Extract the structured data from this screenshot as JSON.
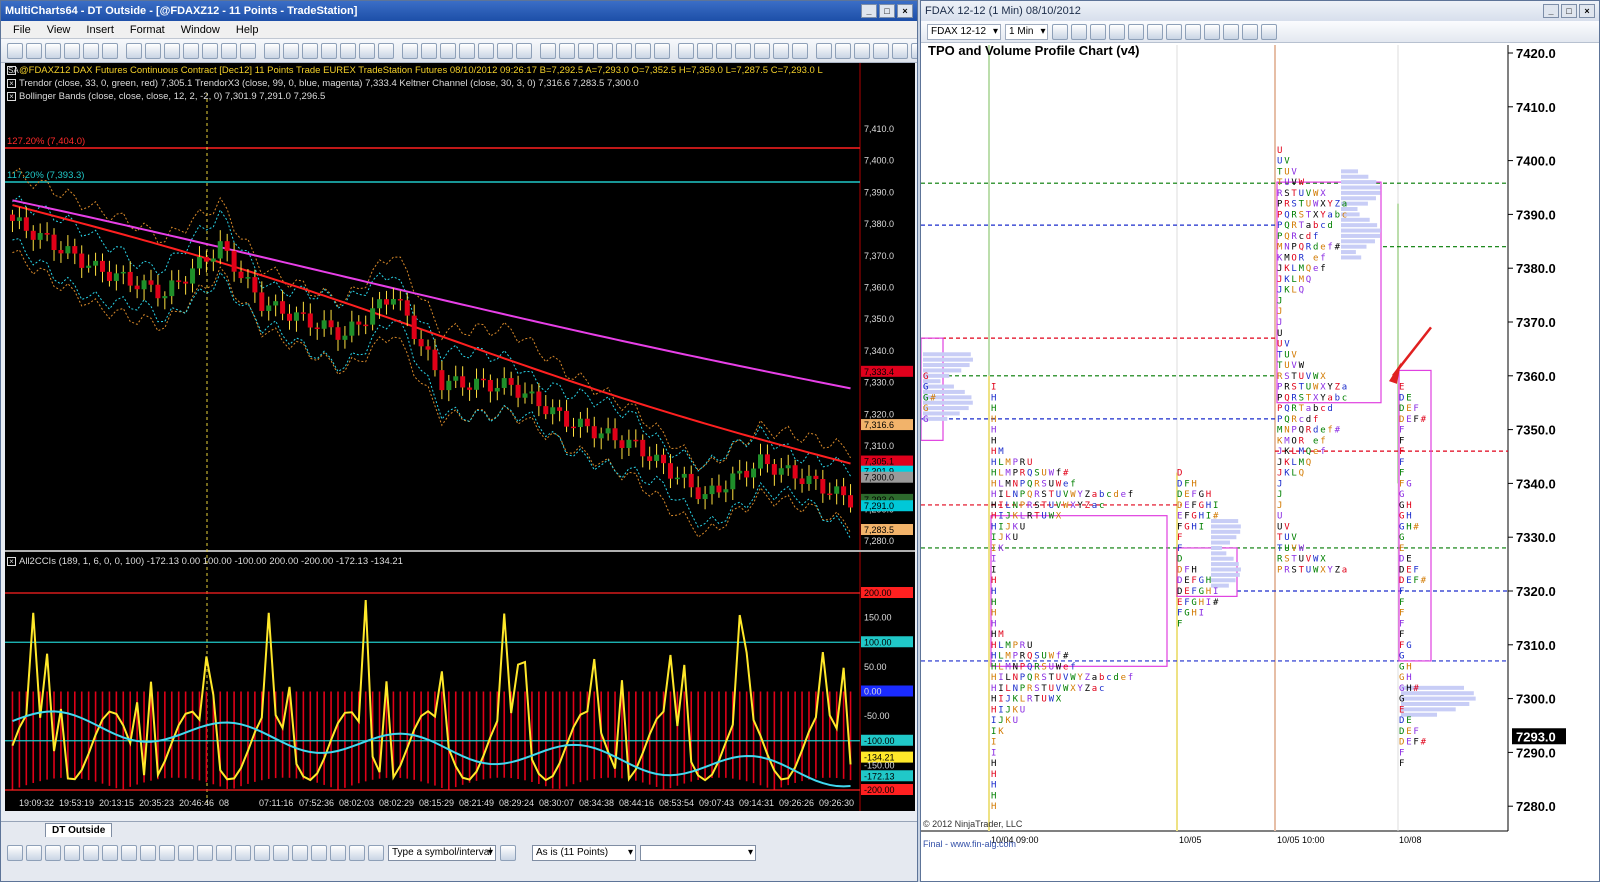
{
  "left_window": {
    "title": "MultiCharts64 - DT Outside - [@FDAXZ12 - 11 Points - TradeStation]",
    "menu": [
      "File",
      "View",
      "Insert",
      "Format",
      "Window",
      "Help"
    ],
    "symbol_line": "@FDAXZ12   DAX Futures Continuous Contract [Dec12]  11 Points   Trade  EUREX  TradeStation  Futures  08/10/2012  09:26:17  B=7,292.5  A=7,293.0  O=7,352.5  H=7,359.0  L=7,287.5  C=7,293.0  L",
    "legend_lines": [
      "Trendor (close, 33, 0, green, red)  7,305.1    TrendorX3 (close, 99, 0, blue, magenta)  7,333.4    Keltner Channel (close, 30, 3, 0)  7,316.6  7,283.5  7,300.0",
      "Bollinger Bands (close, close, close, 12, 2, -2, 0)  7,301.9  7,291.0  7,296.5"
    ],
    "cci_legend": "All2CCIs (189, 1, 6, 0, 0, 100)  -172.13  0.00  100.00  -100.00  200.00  -200.00  -172.13  -134.21",
    "fib_labels": [
      "127.20% (7,404.0)",
      "117.20% (7,393.3)"
    ],
    "price_axis": [
      "7,410.0",
      "7,400.0",
      "7,390.0",
      "7,380.0",
      "7,370.0",
      "7,360.0",
      "7,350.0",
      "7,340.0",
      "7,330.0",
      "7,320.0",
      "7,310.0",
      "7,300.0",
      "7,290.0",
      "7,280.0"
    ],
    "price_markers": [
      {
        "v": "7,333.4",
        "c": "#e0001c"
      },
      {
        "v": "7,316.6",
        "c": "#f2b36a"
      },
      {
        "v": "7,305.1",
        "c": "#e0001c"
      },
      {
        "v": "7,301.9",
        "c": "#00d0e0"
      },
      {
        "v": "7,300.0",
        "c": "#9a9a9a"
      },
      {
        "v": "7,293.0",
        "c": "#2d6a2d"
      },
      {
        "v": "7,291.0",
        "c": "#00c8d8"
      },
      {
        "v": "7,283.5",
        "c": "#f2b36a"
      }
    ],
    "cci_axis": [
      "200.00",
      "150.00",
      "100.00",
      "50.00",
      "0.00",
      "-50.00",
      "-100.00",
      "-134.21",
      "-150.00",
      "-172.13",
      "-200.00"
    ],
    "time_axis": [
      "19:09:32",
      "19:53:19",
      "20:13:15",
      "20:35:23",
      "20:46:46",
      "08",
      "07:11:16",
      "07:52:36",
      "08:02:03",
      "08:02:29",
      "08:15:29",
      "08:21:49",
      "08:29:24",
      "08:30:07",
      "08:34:38",
      "08:44:16",
      "08:53:54",
      "09:07:43",
      "09:14:31",
      "09:26:26",
      "09:26:30"
    ],
    "tab": "DT Outside",
    "symbol_input": "Type a symbol/interval",
    "resolution": "As is (11 Points)"
  },
  "right_window": {
    "title": "FDAX 12-12 (1 Min)  08/10/2012",
    "instrument": "FDAX 12-12",
    "interval": "1 Min",
    "chart_title": "TPO and Volume Profile Chart (v4)",
    "price_axis": [
      "7420.0",
      "7410.0",
      "7400.0",
      "7390.0",
      "7380.0",
      "7370.0",
      "7360.0",
      "7350.0",
      "7340.0",
      "7330.0",
      "7320.0",
      "7310.0",
      "7300.0",
      "7290.0",
      "7280.0"
    ],
    "last_price": "7293.0",
    "dates": [
      "10/04 09:00",
      "10/05",
      "10/05 10:00",
      "10/08"
    ],
    "copyright": "© 2012 NinjaTrader, LLC",
    "credit": "Final - www.fin-alg.com"
  },
  "colors": {
    "bull": "#1f8f2a",
    "bear": "#e00018",
    "magenta": "#e030e0",
    "yellow": "#ffe82a",
    "cyan": "#40d8ee"
  }
}
